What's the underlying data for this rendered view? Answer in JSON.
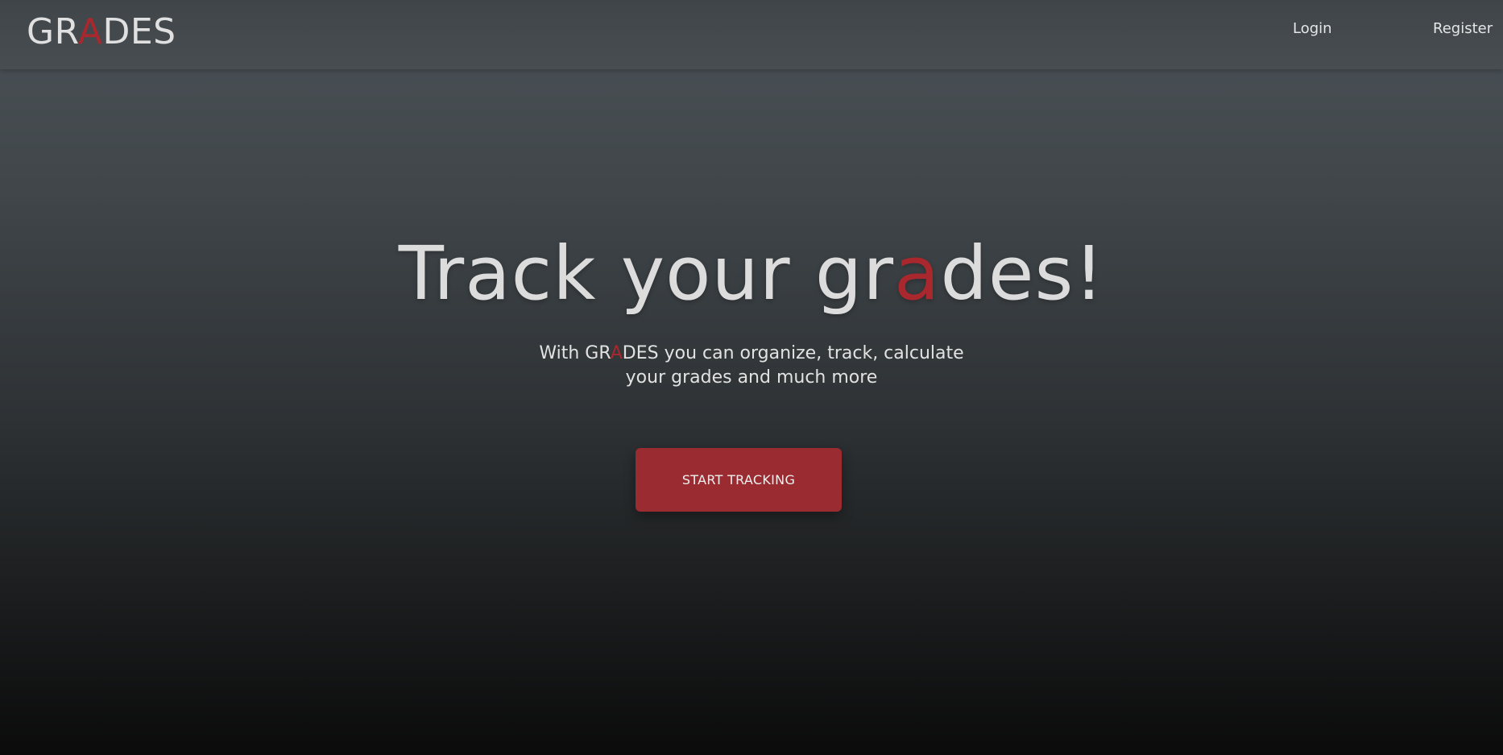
{
  "nav": {
    "logo": {
      "part1": "GR",
      "accent": "A",
      "part2": "DES"
    },
    "login_label": "Login",
    "register_label": "Register"
  },
  "hero": {
    "title": {
      "part1": "Track your gr",
      "accent": "a",
      "part2": "des!"
    },
    "subtitle": {
      "prefix": "With ",
      "brand_part1": "GR",
      "brand_accent": "A",
      "brand_part2": "DES",
      "suffix": " you can organize, track, calculate your grades and much more"
    },
    "cta_label": "START TRACKING"
  },
  "colors": {
    "accent": "#a8282e",
    "button": "#9a2b30",
    "text": "#dcdcdc"
  }
}
